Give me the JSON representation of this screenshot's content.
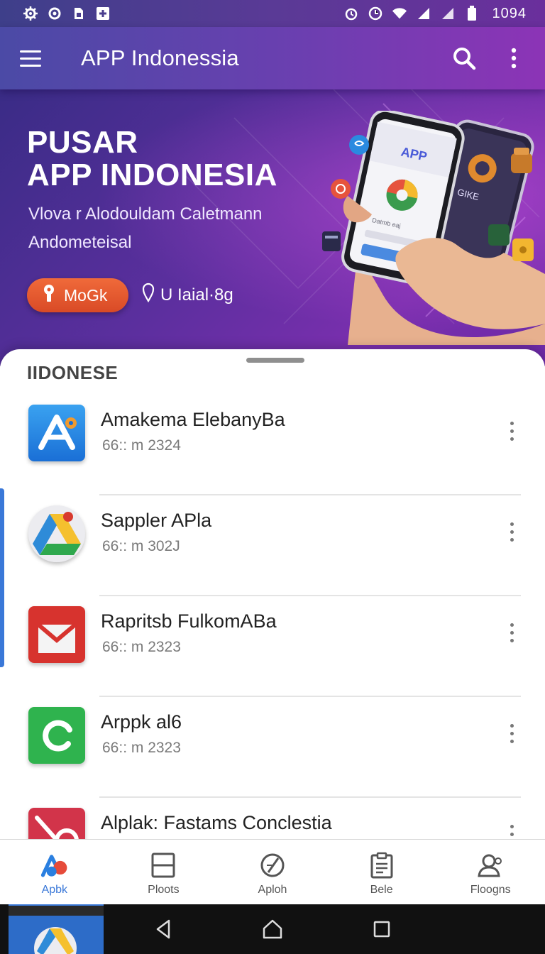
{
  "status_bar": {
    "time": "1094",
    "left_icons": [
      "settings-icon",
      "gear-icon",
      "sim-icon",
      "add-icon"
    ],
    "right_icons": [
      "alarm-icon",
      "clock-icon",
      "wifi-icon",
      "signal-icon",
      "signal-icon",
      "battery-icon"
    ]
  },
  "app_bar": {
    "title": "APP Indonessia",
    "menu_icon": "hamburger-icon",
    "search_icon": "search-icon",
    "more_icon": "more-vertical-icon"
  },
  "hero": {
    "title_line1": "PUSAR",
    "title_line2": "APP INDONESIA",
    "subtitle_line1": "Vlova r Alodouldam Caletmann",
    "subtitle_line2": "Andometeisal",
    "cta_label": "MoGk",
    "secondary_label": "U Iaial·8g",
    "phone_screen_label": "APP",
    "phone_screen_text": "Datmb eaj",
    "side_phone_text": "GIKE",
    "colors": {
      "cta": "#e2552e",
      "bg_start": "#3a2c86",
      "bg_end": "#7a2fae"
    }
  },
  "sheet": {
    "section_title": "IIDONESE",
    "apps": [
      {
        "name": "Amakema ElebanyBa",
        "meta": "66:: m 2324",
        "icon": "app-store-icon"
      },
      {
        "name": "Sappler APla",
        "meta": "66:: m 302J",
        "icon": "drive-icon"
      },
      {
        "name": "Rapritsb FulkomABa",
        "meta": "66:: m 2323",
        "icon": "mail-icon"
      },
      {
        "name": "Arppk al6",
        "meta": "66:: m 2323",
        "icon": "refresh-icon"
      },
      {
        "name": "Alplak: Fastams Conclestia",
        "meta": "",
        "icon": "no-icon"
      }
    ]
  },
  "bottom_nav": {
    "items": [
      {
        "label": "Apbk",
        "icon": "apps-icon",
        "active": true
      },
      {
        "label": "Ploots",
        "icon": "window-icon",
        "active": false
      },
      {
        "label": "Aploh",
        "icon": "compass-icon",
        "active": false
      },
      {
        "label": "Bele",
        "icon": "clipboard-icon",
        "active": false
      },
      {
        "label": "Floogns",
        "icon": "profile-icon",
        "active": false
      }
    ],
    "active_color": "#3a78d8"
  },
  "system_nav": {
    "icons": [
      "back-icon",
      "home-icon",
      "recents-icon"
    ]
  }
}
